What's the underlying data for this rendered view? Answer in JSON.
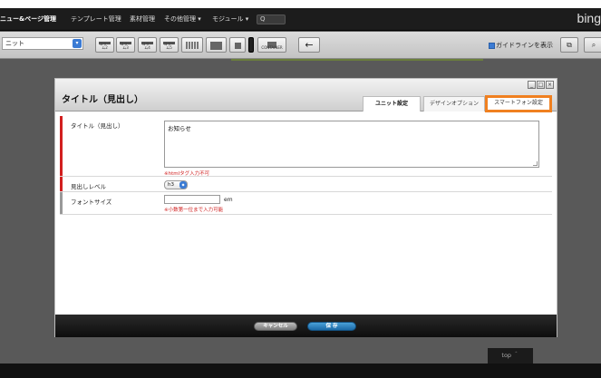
{
  "menubar": {
    "items": [
      "ニュー&ページ管理",
      "テンプレート管理",
      "素材管理",
      "その他管理 ▾",
      "モジュール ▾"
    ],
    "search_label": "Q",
    "brand": "bing"
  },
  "toolbar": {
    "page_select": "ニット",
    "button_labels": [
      "コラーム2",
      "コラーム3",
      "コラーム4",
      "コラーム5",
      "CONTAINER"
    ],
    "guideline_label": "ガイドラインを表示",
    "guideline_checked": true,
    "back_arrow": "←"
  },
  "modal": {
    "title": "タイトル（見出し）",
    "window_controls": [
      "_",
      "□",
      "×"
    ],
    "tabs": [
      "ユニット設定",
      "デザインオプション",
      "スマートフォン設定"
    ],
    "active_tab": "ユニット設定",
    "highlighted_tab": "スマートフォン設定",
    "highlight_color": "#f08020",
    "fields": {
      "title": {
        "label": "タイトル（見出し）",
        "value": "お知らせ",
        "note": "※htmlタグ入力不可",
        "marker_color": "#d21f1f"
      },
      "heading_level": {
        "label": "見出しレベル",
        "value": "h3"
      },
      "font_size": {
        "label": "フォントサイズ",
        "value": "",
        "unit": "em",
        "note": "※小数第一位まで入力可能",
        "marker_color": "#999999"
      }
    },
    "buttons": {
      "cancel": "キャンセル",
      "save": "保 存"
    }
  },
  "footer": {
    "top_link": "top ＾"
  }
}
